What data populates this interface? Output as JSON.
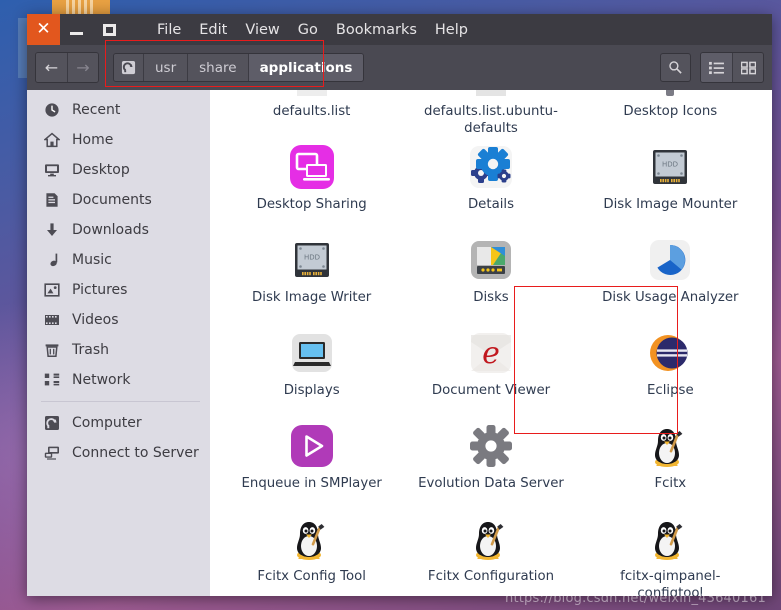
{
  "window": {
    "controls": {
      "close": "✕",
      "minimize": "minimize",
      "maximize": "maximize"
    },
    "menu": [
      "File",
      "Edit",
      "View",
      "Go",
      "Bookmarks",
      "Help"
    ]
  },
  "toolbar": {
    "back": "←",
    "forward": "→",
    "breadcrumb": [
      {
        "label": "",
        "icon": "computer-icon",
        "active": false
      },
      {
        "label": "usr",
        "icon": "",
        "active": false
      },
      {
        "label": "share",
        "icon": "",
        "active": false
      },
      {
        "label": "applications",
        "icon": "",
        "active": true
      }
    ],
    "search_label": "search-icon",
    "list_view_label": "list-view-icon",
    "grid_view_label": "grid-view-icon"
  },
  "sidebar": {
    "items": [
      {
        "label": "Recent",
        "icon": "clock-icon"
      },
      {
        "label": "Home",
        "icon": "home-icon"
      },
      {
        "label": "Desktop",
        "icon": "desktop-icon"
      },
      {
        "label": "Documents",
        "icon": "documents-icon"
      },
      {
        "label": "Downloads",
        "icon": "download-icon"
      },
      {
        "label": "Music",
        "icon": "music-note-icon"
      },
      {
        "label": "Pictures",
        "icon": "pictures-icon"
      },
      {
        "label": "Videos",
        "icon": "videos-icon"
      },
      {
        "label": "Trash",
        "icon": "trash-icon"
      },
      {
        "label": "Network",
        "icon": "network-icon"
      }
    ],
    "items_secondary": [
      {
        "label": "Computer",
        "icon": "computer-icon"
      },
      {
        "label": "Connect to Server",
        "icon": "connect-server-icon"
      }
    ]
  },
  "files": [
    {
      "name": "defaults.list",
      "icon": "text-file-icon"
    },
    {
      "name": "defaults.list.ubuntu-defaults",
      "icon": "text-file-link-icon"
    },
    {
      "name": "Desktop Icons",
      "icon": "gear-dark-icon"
    },
    {
      "name": "Desktop Sharing",
      "icon": "desktop-sharing-icon"
    },
    {
      "name": "Details",
      "icon": "details-gears-icon"
    },
    {
      "name": "Disk Image Mounter",
      "icon": "hdd-icon"
    },
    {
      "name": "Disk Image Writer",
      "icon": "hdd-icon"
    },
    {
      "name": "Disks",
      "icon": "disks-icon"
    },
    {
      "name": "Disk Usage Analyzer",
      "icon": "pie-chart-icon"
    },
    {
      "name": "Displays",
      "icon": "laptop-icon"
    },
    {
      "name": "Document Viewer",
      "icon": "evince-e-icon"
    },
    {
      "name": "Eclipse",
      "icon": "eclipse-icon"
    },
    {
      "name": "Enqueue in SMPlayer",
      "icon": "smplayer-icon"
    },
    {
      "name": "Evolution Data Server",
      "icon": "gear-gray-icon"
    },
    {
      "name": "Fcitx",
      "icon": "penguin-icon"
    },
    {
      "name": "Fcitx Config Tool",
      "icon": "penguin-icon"
    },
    {
      "name": "Fcitx Configuration",
      "icon": "penguin-icon"
    },
    {
      "name": "fcitx-qimpanel-configtool",
      "icon": "penguin-icon"
    }
  ],
  "annotations": {
    "path_box": "highlight-path-breadcrumb",
    "eclipse_box": "highlight-eclipse-item"
  },
  "watermark": "https://blog.csdn.net/weixin_43640161",
  "colors": {
    "close_button": "#e2571e",
    "menubar": "#3c3b42",
    "toolbar": "#4a4952",
    "sidebar": "#dddce4",
    "annotation": "#e81c1c",
    "label_text": "#2f3b50"
  }
}
